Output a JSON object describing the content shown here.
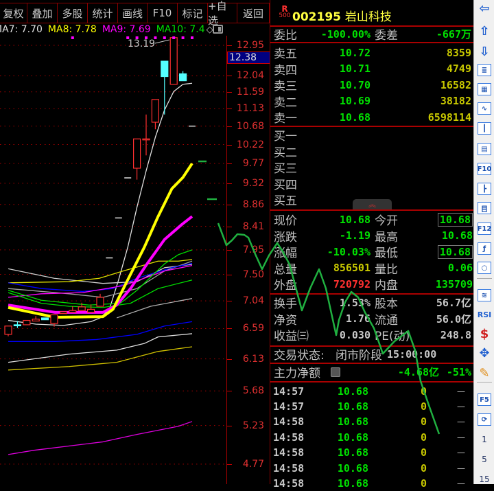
{
  "toolbar": {
    "buttons": [
      "复权",
      "叠加",
      "多股",
      "统计",
      "画线",
      "F10",
      "标记",
      "+自选",
      "返回"
    ]
  },
  "ma_legend": [
    {
      "label": "MA7: 7.70",
      "color": "#e0e0e0"
    },
    {
      "label": "MA8: 7.78",
      "color": "#ffff00"
    },
    {
      "label": "MA9: 7.69",
      "color": "#ff00ff"
    },
    {
      "label": "MA10: 7.4",
      "color": "#00e000"
    }
  ],
  "chart_data": {
    "type": "candlestick",
    "price_ticks": [
      "12.95",
      "12.04",
      "11.59",
      "11.13",
      "10.68",
      "10.22",
      "9.77",
      "9.32",
      "8.86",
      "8.41",
      "7.95",
      "7.50",
      "7.04",
      "6.59",
      "6.13",
      "5.68",
      "5.23",
      "4.77"
    ],
    "current_price_marker": "12.38",
    "high_label": "13.19",
    "signal_dot_bars": [
      7,
      13,
      14,
      15,
      16,
      17,
      18,
      19,
      20
    ],
    "candles": [
      {
        "o": 6.63,
        "c": 6.5,
        "h": 6.47,
        "l": 6.47,
        "up": true,
        "hi": 6.63
      },
      {
        "o": 6.65,
        "c": 6.65,
        "h": 6.71,
        "l": 6.6,
        "up": false
      },
      {
        "o": 6.65,
        "c": 6.72,
        "h": 6.72,
        "l": 6.65,
        "up": true
      },
      {
        "o": 6.71,
        "c": 6.74,
        "h": 6.79,
        "l": 6.71,
        "up": true
      },
      {
        "o": 6.76,
        "c": 6.73,
        "h": 6.76,
        "l": 6.73,
        "up": false
      },
      {
        "o": 6.67,
        "c": 6.81,
        "h": 6.81,
        "l": 6.62,
        "up": true
      },
      {
        "o": 6.83,
        "c": 6.86,
        "h": 6.86,
        "l": 6.83,
        "up": true
      },
      {
        "o": 6.85,
        "c": 6.88,
        "h": 6.95,
        "l": 6.85,
        "up": true
      },
      {
        "o": 6.88,
        "c": 6.94,
        "h": 7.01,
        "l": 6.88,
        "up": true
      },
      {
        "o": 6.85,
        "c": 6.9,
        "h": 6.98,
        "l": 6.85,
        "up": true
      },
      {
        "o": 6.95,
        "c": 7.1,
        "h": 7.16,
        "l": 6.95,
        "up": true
      },
      {
        "o": 7.8,
        "c": 7.8,
        "h": 7.8,
        "l": 7.8,
        "up": true
      },
      {
        "o": 8.58,
        "c": 8.58,
        "h": 8.58,
        "l": 8.58,
        "up": true
      },
      {
        "o": 9.44,
        "c": 9.44,
        "h": 9.44,
        "l": 9.44,
        "up": true
      },
      {
        "o": 9.66,
        "c": 10.36,
        "h": 10.36,
        "l": 9.4,
        "up": true
      },
      {
        "o": 10.34,
        "c": 10.36,
        "h": 10.98,
        "l": 9.96,
        "up": true
      },
      {
        "o": 10.78,
        "c": 11.38,
        "h": 11.38,
        "l": 10.6,
        "up": true
      },
      {
        "o": 12.47,
        "c": 12.02,
        "h": 12.47,
        "l": 10.98,
        "up": false
      },
      {
        "o": 11.8,
        "c": 13.19,
        "h": 13.19,
        "l": 11.8,
        "up": true
      },
      {
        "o": 12.1,
        "c": 11.9,
        "h": 12.18,
        "l": 11.9,
        "up": false
      },
      {
        "o": 10.68,
        "c": 10.68,
        "h": 10.68,
        "l": 10.68,
        "up": false
      }
    ],
    "ma_series": [
      {
        "color": "#e0e0e0",
        "thick": false,
        "points": [
          [
            0,
            6.72
          ],
          [
            3,
            6.66
          ],
          [
            6,
            6.64
          ],
          [
            9,
            6.7
          ],
          [
            10,
            6.76
          ],
          [
            11,
            6.9
          ],
          [
            12,
            7.4
          ],
          [
            13,
            8.0
          ],
          [
            14,
            8.8
          ],
          [
            15,
            9.6
          ],
          [
            16,
            10.4
          ],
          [
            17,
            11.1
          ],
          [
            18,
            11.6
          ],
          [
            19,
            11.8
          ],
          [
            20,
            11.83
          ]
        ]
      },
      {
        "color": "#d0d0d0",
        "thick": false,
        "points": [
          [
            0,
            7.6
          ],
          [
            5,
            7.43
          ],
          [
            10.3,
            7.34
          ],
          [
            14,
            7.37
          ],
          [
            17,
            7.62
          ],
          [
            20,
            7.68
          ]
        ]
      },
      {
        "color": "#a0a0a0",
        "thick": false,
        "points": [
          [
            0,
            7.25
          ],
          [
            6.6,
            7.16
          ],
          [
            10.3,
            7.1
          ],
          [
            14,
            7.25
          ],
          [
            17,
            7.56
          ],
          [
            20,
            7.74
          ]
        ]
      },
      {
        "color": "#e0e000",
        "thick": false,
        "points": [
          [
            0,
            7.35
          ],
          [
            6.6,
            7.37
          ],
          [
            9.9,
            7.43
          ],
          [
            12.5,
            7.56
          ],
          [
            16.3,
            7.74
          ],
          [
            18.5,
            7.74
          ],
          [
            20,
            7.77
          ]
        ]
      },
      {
        "color": "#0000ff",
        "thick": false,
        "points": [
          [
            0,
            7.35
          ],
          [
            3.6,
            7.25
          ],
          [
            8.1,
            7.2
          ],
          [
            11.4,
            7.25
          ],
          [
            14,
            7.43
          ],
          [
            17.8,
            7.62
          ],
          [
            20,
            7.7
          ]
        ]
      },
      {
        "color": "#ff00ff",
        "thick": false,
        "points": [
          [
            0,
            7.1
          ],
          [
            3.6,
            7.16
          ],
          [
            8.1,
            7.18
          ],
          [
            12.5,
            7.3
          ],
          [
            17,
            7.56
          ],
          [
            20,
            7.66
          ]
        ]
      },
      {
        "color": "#00e000",
        "thick": false,
        "points": [
          [
            0,
            7.18
          ],
          [
            3.6,
            7.0
          ],
          [
            6.6,
            6.95
          ],
          [
            10.3,
            6.93
          ],
          [
            13.3,
            7.0
          ],
          [
            16.3,
            7.25
          ],
          [
            20,
            7.4
          ]
        ]
      },
      {
        "color": "#00e000",
        "thick": false,
        "points": [
          [
            0,
            7.22
          ],
          [
            3.6,
            7.05
          ],
          [
            8.8,
            6.97
          ],
          [
            12.2,
            7.0
          ],
          [
            14,
            7.22
          ],
          [
            17,
            7.69
          ],
          [
            18.5,
            7.86
          ],
          [
            20,
            7.95
          ]
        ]
      },
      {
        "color": "#ff00ff",
        "thick": true,
        "points": [
          [
            0,
            6.97
          ],
          [
            5.1,
            6.85
          ],
          [
            10.3,
            6.85
          ],
          [
            11.8,
            6.97
          ],
          [
            13.3,
            7.25
          ],
          [
            15.1,
            7.69
          ],
          [
            17,
            8.15
          ],
          [
            18.9,
            8.45
          ],
          [
            20,
            8.61
          ]
        ]
      },
      {
        "color": "#ffff00",
        "thick": true,
        "points": [
          [
            0,
            6.93
          ],
          [
            5.1,
            6.77
          ],
          [
            10.3,
            6.78
          ],
          [
            11.4,
            6.9
          ],
          [
            13.3,
            7.5
          ],
          [
            14.8,
            8.0
          ],
          [
            16.3,
            8.61
          ],
          [
            17.8,
            9.2
          ],
          [
            19,
            9.45
          ],
          [
            20,
            9.77
          ]
        ]
      },
      {
        "color": "#b0b0b0",
        "thick": false,
        "points": [
          [
            11.8,
            6.76
          ],
          [
            15.5,
            6.95
          ],
          [
            20,
            7.08
          ]
        ]
      },
      {
        "color": "#0000ff",
        "thick": false,
        "points": [
          [
            0,
            6.39
          ],
          [
            5.1,
            6.39
          ],
          [
            9.6,
            6.42
          ],
          [
            14,
            6.5
          ],
          [
            17,
            6.63
          ],
          [
            20,
            6.7
          ]
        ]
      },
      {
        "color": "#e0e0e0",
        "thick": false,
        "points": [
          [
            0,
            6.08
          ],
          [
            6.6,
            6.2
          ],
          [
            11.8,
            6.26
          ],
          [
            14.8,
            6.36
          ],
          [
            16.3,
            6.46
          ],
          [
            20,
            6.51
          ]
        ]
      },
      {
        "color": "#d0c000",
        "thick": false,
        "points": [
          [
            0,
            5.97
          ],
          [
            6.6,
            6.02
          ],
          [
            11.8,
            6.08
          ],
          [
            16.3,
            6.24
          ],
          [
            20,
            6.31
          ]
        ]
      },
      {
        "color": "#e000e0",
        "thick": false,
        "points": [
          [
            0,
            4.88
          ],
          [
            2.8,
            4.93
          ],
          [
            10.3,
            5.03
          ],
          [
            14,
            5.12
          ],
          [
            18.5,
            5.22
          ],
          [
            20,
            5.28
          ]
        ]
      }
    ]
  },
  "quote": {
    "badge_top": "R",
    "badge_bottom": "500",
    "code": "002195",
    "name": "岩山科技",
    "wei_bi_label": "委比",
    "wei_bi": "-100.00%",
    "wei_cha_label": "委差",
    "wei_cha": "-667万",
    "sells": [
      {
        "label": "卖五",
        "price": "10.72",
        "vol": "8359"
      },
      {
        "label": "卖四",
        "price": "10.71",
        "vol": "4749"
      },
      {
        "label": "卖三",
        "price": "10.70",
        "vol": "16582"
      },
      {
        "label": "卖二",
        "price": "10.69",
        "vol": "38182"
      },
      {
        "label": "卖一",
        "price": "10.68",
        "vol": "6598114"
      }
    ],
    "buys": [
      {
        "label": "买一"
      },
      {
        "label": "买二"
      },
      {
        "label": "买三"
      },
      {
        "label": "买四"
      },
      {
        "label": "买五"
      }
    ],
    "stats": [
      {
        "l1": "现价",
        "v1": "10.68",
        "c1": "g",
        "l2": "今开",
        "v2": "10.68",
        "c2": "g",
        "box2": true
      },
      {
        "l1": "涨跌",
        "v1": "-1.19",
        "c1": "g",
        "l2": "最高",
        "v2": "10.68",
        "c2": "g"
      },
      {
        "l1": "涨幅",
        "v1": "-10.03%",
        "c1": "g",
        "l2": "最低",
        "v2": "10.68",
        "c2": "g",
        "box2": true
      },
      {
        "l1": "总量",
        "v1": "856501",
        "c1": "y",
        "l2": "量比",
        "v2": "0.06",
        "c2": "g"
      },
      {
        "l1": "外盘",
        "v1": "720792",
        "c1": "r",
        "l2": "内盘",
        "v2": "135709",
        "c2": "g"
      }
    ],
    "fundamentals": [
      {
        "l1": "换手",
        "v1": "1.53%",
        "l2": "股本",
        "v2": "56.7亿"
      },
      {
        "l1": "净资",
        "v1": "1.76",
        "l2": "流通",
        "v2": "56.0亿"
      },
      {
        "l1": "收益㈢",
        "v1": "0.030",
        "l2": "PE(动)",
        "v2": "248.8"
      }
    ],
    "trade_status_label": "交易状态:",
    "trade_status": "闭市阶段",
    "trade_status_time": "15:00:00",
    "main_force_label": "主力净额",
    "main_force_value": "-4.68亿",
    "main_force_pct": "-51%",
    "ticks": [
      {
        "time": "14:57",
        "price": "10.68",
        "vol": "0",
        "dir": "—"
      },
      {
        "time": "14:57",
        "price": "10.68",
        "vol": "0",
        "dir": "—"
      },
      {
        "time": "14:58",
        "price": "10.68",
        "vol": "0",
        "dir": "—"
      },
      {
        "time": "14:58",
        "price": "10.68",
        "vol": "0",
        "dir": "—"
      },
      {
        "time": "14:58",
        "price": "10.68",
        "vol": "0",
        "dir": "—"
      },
      {
        "time": "14:58",
        "price": "10.68",
        "vol": "0",
        "dir": "—"
      },
      {
        "time": "14:58",
        "price": "10.68",
        "vol": "0",
        "dir": "—"
      }
    ]
  },
  "sidebar": {
    "items": [
      {
        "icon": "arrow-left",
        "glyph": "⇦"
      },
      {
        "icon": "arrow-up",
        "glyph": "⇧"
      },
      {
        "icon": "arrow-down",
        "glyph": "⇩"
      },
      {
        "icon": "quote-list",
        "glyph": "≣"
      },
      {
        "icon": "multi-grid",
        "glyph": "▦"
      },
      {
        "icon": "line-chart",
        "glyph": "∿"
      },
      {
        "icon": "candlestick",
        "glyph": "┃"
      },
      {
        "icon": "windows",
        "glyph": "▤"
      },
      {
        "icon": "f10",
        "glyph": "F10"
      },
      {
        "icon": "tree",
        "glyph": "┣"
      },
      {
        "icon": "notes",
        "glyph": "目"
      },
      {
        "icon": "f12",
        "glyph": "F12"
      },
      {
        "icon": "formula",
        "glyph": "ƒ"
      },
      {
        "icon": "cycle",
        "glyph": "○"
      },
      {
        "icon": "indicator-waves",
        "glyph": "≋"
      },
      {
        "icon": "rsi",
        "glyph": "RSI"
      },
      {
        "icon": "money",
        "glyph": "$"
      },
      {
        "icon": "move",
        "glyph": "✥"
      },
      {
        "icon": "pencil",
        "glyph": "✎"
      },
      {
        "icon": "f5",
        "glyph": "F5"
      },
      {
        "icon": "refresh",
        "glyph": "⟳"
      }
    ],
    "periods": [
      "1",
      "5",
      "15"
    ]
  }
}
